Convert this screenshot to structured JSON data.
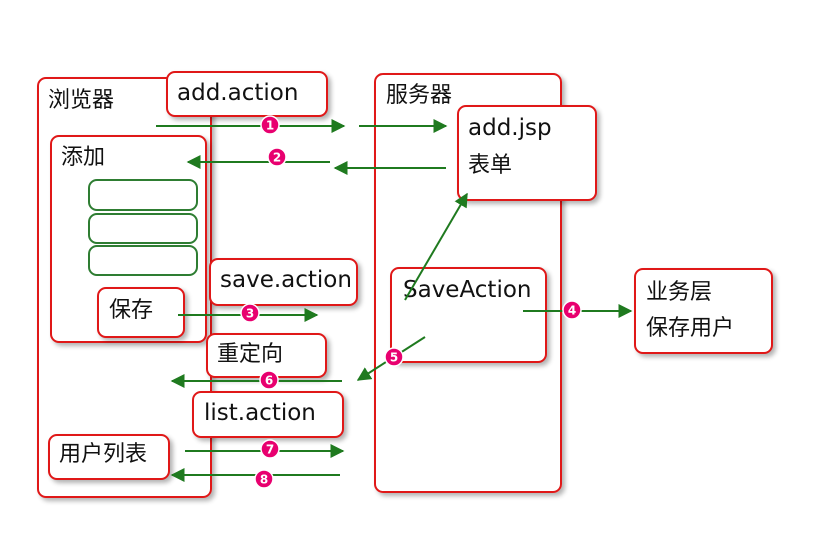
{
  "browser": {
    "title": "浏览器"
  },
  "server": {
    "title": "服务器"
  },
  "actions": {
    "add": "add.action",
    "save": "save.action",
    "redirect": "重定向",
    "list": "list.action"
  },
  "add_form": {
    "title": "添加",
    "save_button": "保存"
  },
  "user_list": {
    "label": "用户列表"
  },
  "add_jsp": {
    "line1": "add.jsp",
    "line2": "表单"
  },
  "save_action": {
    "label": "SaveAction"
  },
  "business": {
    "line1": "业务层",
    "line2": "保存用户"
  },
  "steps": [
    {
      "symbol": "1"
    },
    {
      "symbol": "2"
    },
    {
      "symbol": "3"
    },
    {
      "symbol": "4"
    },
    {
      "symbol": "5"
    },
    {
      "symbol": "6"
    },
    {
      "symbol": "7"
    },
    {
      "symbol": "8"
    }
  ],
  "colors": {
    "box_border": "#e01818",
    "arrow": "#1f7a1f",
    "badge": "#e8006f",
    "field_border": "#2e7d32"
  }
}
